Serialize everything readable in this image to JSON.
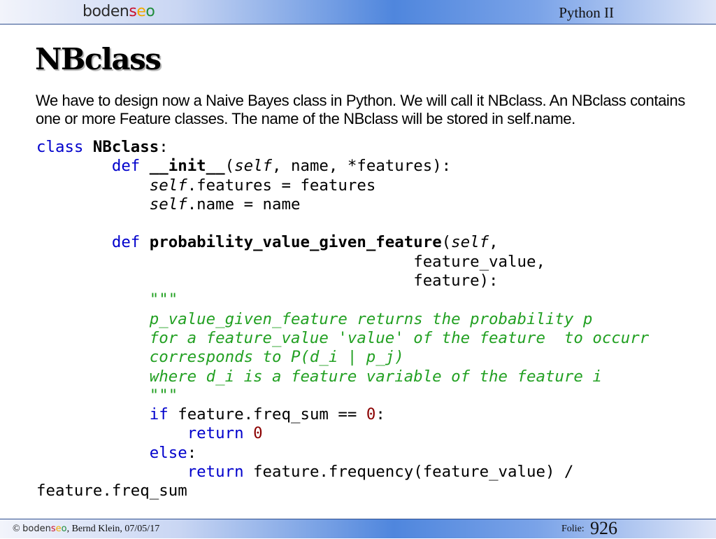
{
  "header": {
    "logo": {
      "part1": "boden",
      "s": "s",
      "e": "e",
      "o": "o"
    },
    "title": "Python II"
  },
  "slide": {
    "title": "NBclass",
    "intro": "We have to design now a Naive Bayes class in Python. We will call it NBclass. An NBclass contains one or more Feature classes. The name of the NBclass will be stored in self.name."
  },
  "code": {
    "lines": [
      [
        {
          "t": "class",
          "s": "kw"
        },
        {
          "t": " "
        },
        {
          "t": "NBclass",
          "s": "fn"
        },
        {
          "t": ":"
        }
      ],
      [
        {
          "t": "        "
        },
        {
          "t": "def",
          "s": "kw"
        },
        {
          "t": " "
        },
        {
          "t": "__init__",
          "s": "fn"
        },
        {
          "t": "("
        },
        {
          "t": "self",
          "s": "self"
        },
        {
          "t": ", name, *features):"
        }
      ],
      [
        {
          "t": "            "
        },
        {
          "t": "self",
          "s": "self"
        },
        {
          "t": ".features = features"
        }
      ],
      [
        {
          "t": "            "
        },
        {
          "t": "self",
          "s": "self"
        },
        {
          "t": ".name = name"
        }
      ],
      [],
      [
        {
          "t": "        "
        },
        {
          "t": "def",
          "s": "kw"
        },
        {
          "t": " "
        },
        {
          "t": "probability_value_given_feature",
          "s": "fn"
        },
        {
          "t": "("
        },
        {
          "t": "self",
          "s": "self"
        },
        {
          "t": ","
        }
      ],
      [
        {
          "t": "                                        feature_value,"
        }
      ],
      [
        {
          "t": "                                        feature):"
        }
      ],
      [
        {
          "t": "            \"\"\"",
          "s": "cmt"
        }
      ],
      [
        {
          "t": "            p_value_given_feature returns the probability p",
          "s": "cmt"
        }
      ],
      [
        {
          "t": "            for a feature_value 'value' of the feature  to occurr",
          "s": "cmt"
        }
      ],
      [
        {
          "t": "            corresponds to P(d_i | p_j)",
          "s": "cmt"
        }
      ],
      [
        {
          "t": "            where d_i is a feature variable of the feature i",
          "s": "cmt"
        }
      ],
      [
        {
          "t": "            \"\"\"",
          "s": "cmt"
        }
      ],
      [
        {
          "t": "            "
        },
        {
          "t": "if",
          "s": "kw"
        },
        {
          "t": " feature.freq_sum == "
        },
        {
          "t": "0",
          "s": "num"
        },
        {
          "t": ":"
        }
      ],
      [
        {
          "t": "                "
        },
        {
          "t": "return",
          "s": "kw"
        },
        {
          "t": " "
        },
        {
          "t": "0",
          "s": "num"
        }
      ],
      [
        {
          "t": "            "
        },
        {
          "t": "else",
          "s": "kw"
        },
        {
          "t": ":"
        }
      ],
      [
        {
          "t": "                "
        },
        {
          "t": "return",
          "s": "kw"
        },
        {
          "t": " feature.frequency(feature_value) /"
        }
      ],
      [
        {
          "t": "feature.freq_sum"
        }
      ]
    ]
  },
  "footer": {
    "copyright": "©",
    "brand": {
      "part1": "boden",
      "s": "s",
      "e": "e",
      "o": "o"
    },
    "author_date": ", Bernd Klein, 07/05/17",
    "folie_label": "Folie:",
    "page_number": "926"
  }
}
